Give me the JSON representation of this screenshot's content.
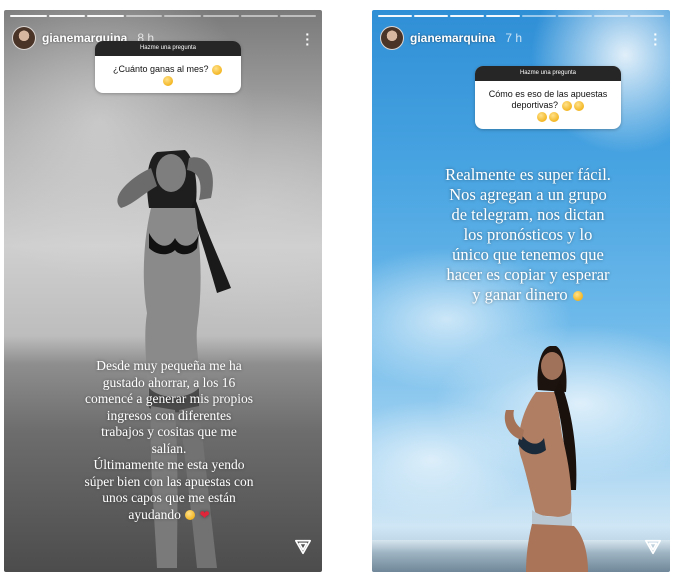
{
  "left_story": {
    "username": "gianemarquina",
    "time": "8 h",
    "question_header": "Hazme una pregunta",
    "question": "¿Cuánto ganas al mes?",
    "caption_lines": [
      "Desde muy pequeña me ha",
      "gustado ahorrar, a los 16",
      "comencé a generar mis propios",
      "ingresos con diferentes",
      "trabajos y cositas que me",
      "salían.",
      "Últimamente me esta yendo",
      "súper bien con las apuestas con",
      "unos capos que me están",
      "ayudando"
    ]
  },
  "right_story": {
    "username": "gianemarquina",
    "time": "7 h",
    "question_header": "Hazme una pregunta",
    "question": "Cómo es eso de las apuestas deportivas?",
    "caption_lines": [
      "Realmente es super fácil.",
      "Nos agregan a un grupo",
      "de telegram, nos dictan",
      "los pronósticos y lo",
      "único que tenemos que",
      "hacer es copiar y esperar",
      "y ganar dinero"
    ]
  },
  "colors": {
    "question_header_bg": "#262626",
    "card_bg": "#ffffff",
    "sky_blue": "#4aa5e2"
  },
  "icons": [
    "more-icon",
    "send-icon",
    "emoji-icon"
  ]
}
